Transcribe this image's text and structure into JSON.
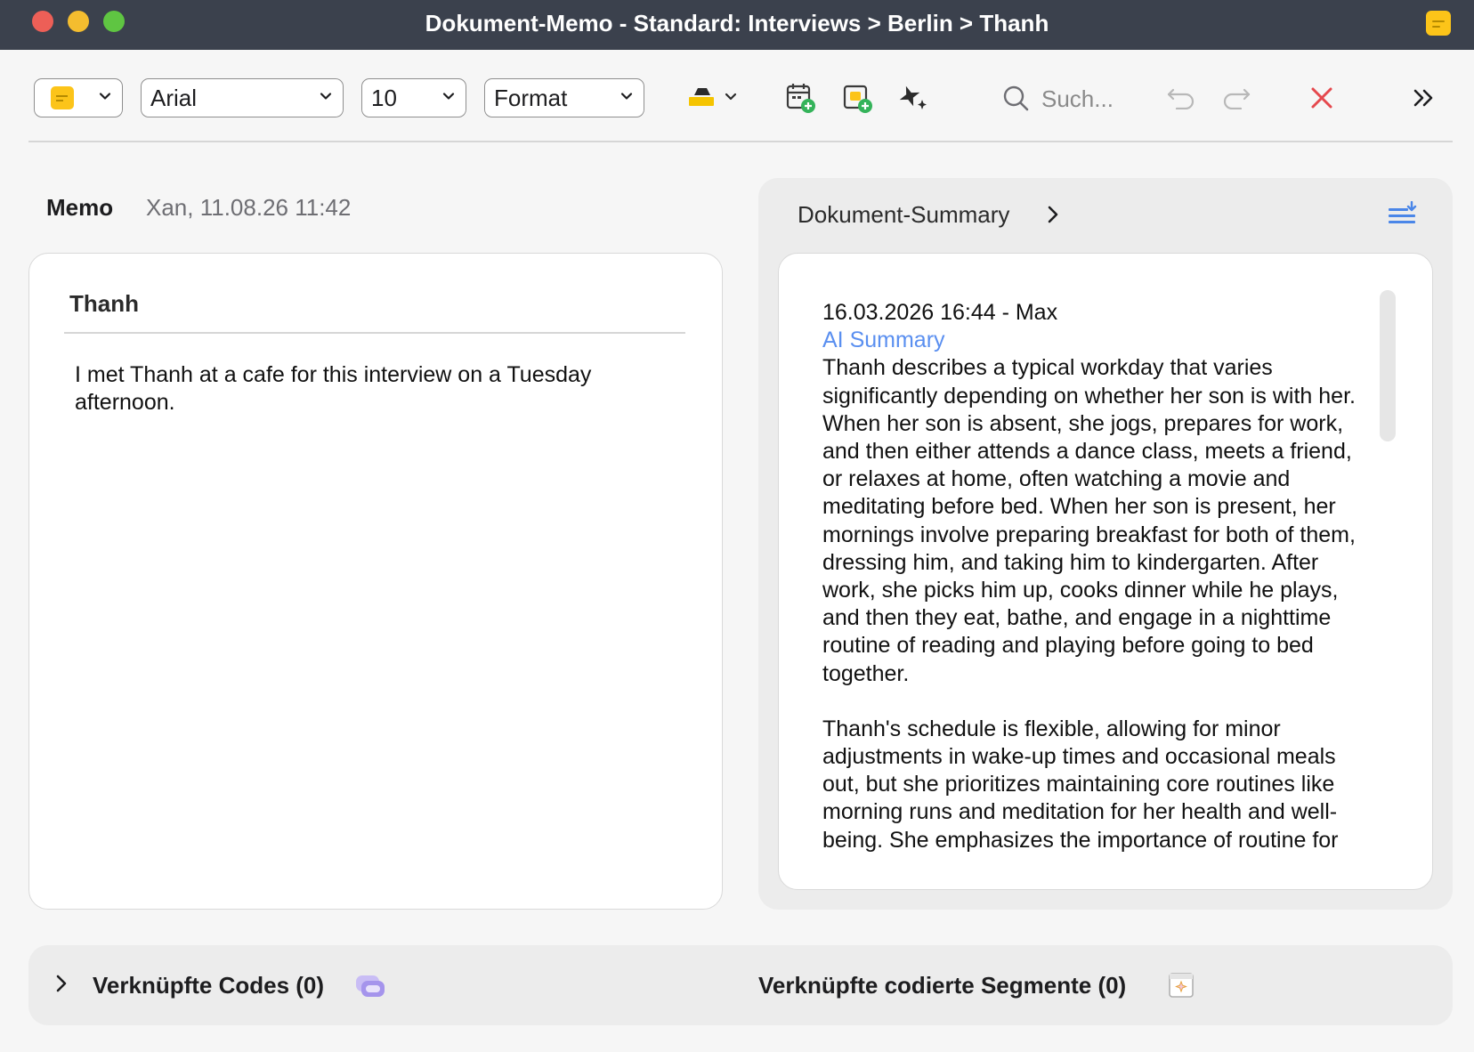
{
  "window": {
    "title": "Dokument-Memo - Standard: Interviews > Berlin > Thanh",
    "memo_icon": "memo-yellow-icon"
  },
  "toolbar": {
    "memo_type": {
      "icon": "memo-yellow-icon",
      "color": "#fcc419"
    },
    "font": "Arial",
    "font_size": "10",
    "format": "Format",
    "icons": [
      "highlighter-icon",
      "calendar-add-icon",
      "memo-add-icon",
      "ai-sparkle-icon",
      "undo-icon",
      "redo-icon",
      "close-icon",
      "more-icon"
    ],
    "search_placeholder": "Such..."
  },
  "memo": {
    "label": "Memo",
    "meta": "Xan, 11.08.26 11:42",
    "title": "Thanh",
    "body": "I met Thanh at a cafe for this interview on a Tuesday afternoon."
  },
  "summary": {
    "header": "Dokument-Summary",
    "timestamp_line": "16.03.2026 16:44 - Max",
    "ai_label": "AI Summary",
    "paragraph_1": "Thanh describes a typical workday that varies significantly depending on whether her son is with her. When her son is absent, she jogs, prepares for work, and then either attends a dance class, meets a friend, or relaxes at home, often watching a movie and meditating before bed. When her son is present, her mornings involve preparing breakfast for both of them, dressing him, and taking him to kindergarten. After work, she picks him up, cooks dinner while he plays, and then they eat, bathe, and engage in a nighttime routine of reading and playing before going to bed together.",
    "paragraph_2": "Thanh's schedule is flexible, allowing for minor adjustments in wake-up times and occasional meals out, but she prioritizes maintaining core routines like morning runs and meditation for her health and well-being. She emphasizes the importance of routine for"
  },
  "bottom": {
    "codes_label": "Verknüpfte Codes (0)",
    "segments_label": "Verknüpfte codierte Segmente (0)"
  },
  "colors": {
    "titlebar": "#3b414d",
    "accent_blue": "#5a8ff0",
    "close_red": "#e5484d",
    "memo_yellow": "#fcc419"
  }
}
